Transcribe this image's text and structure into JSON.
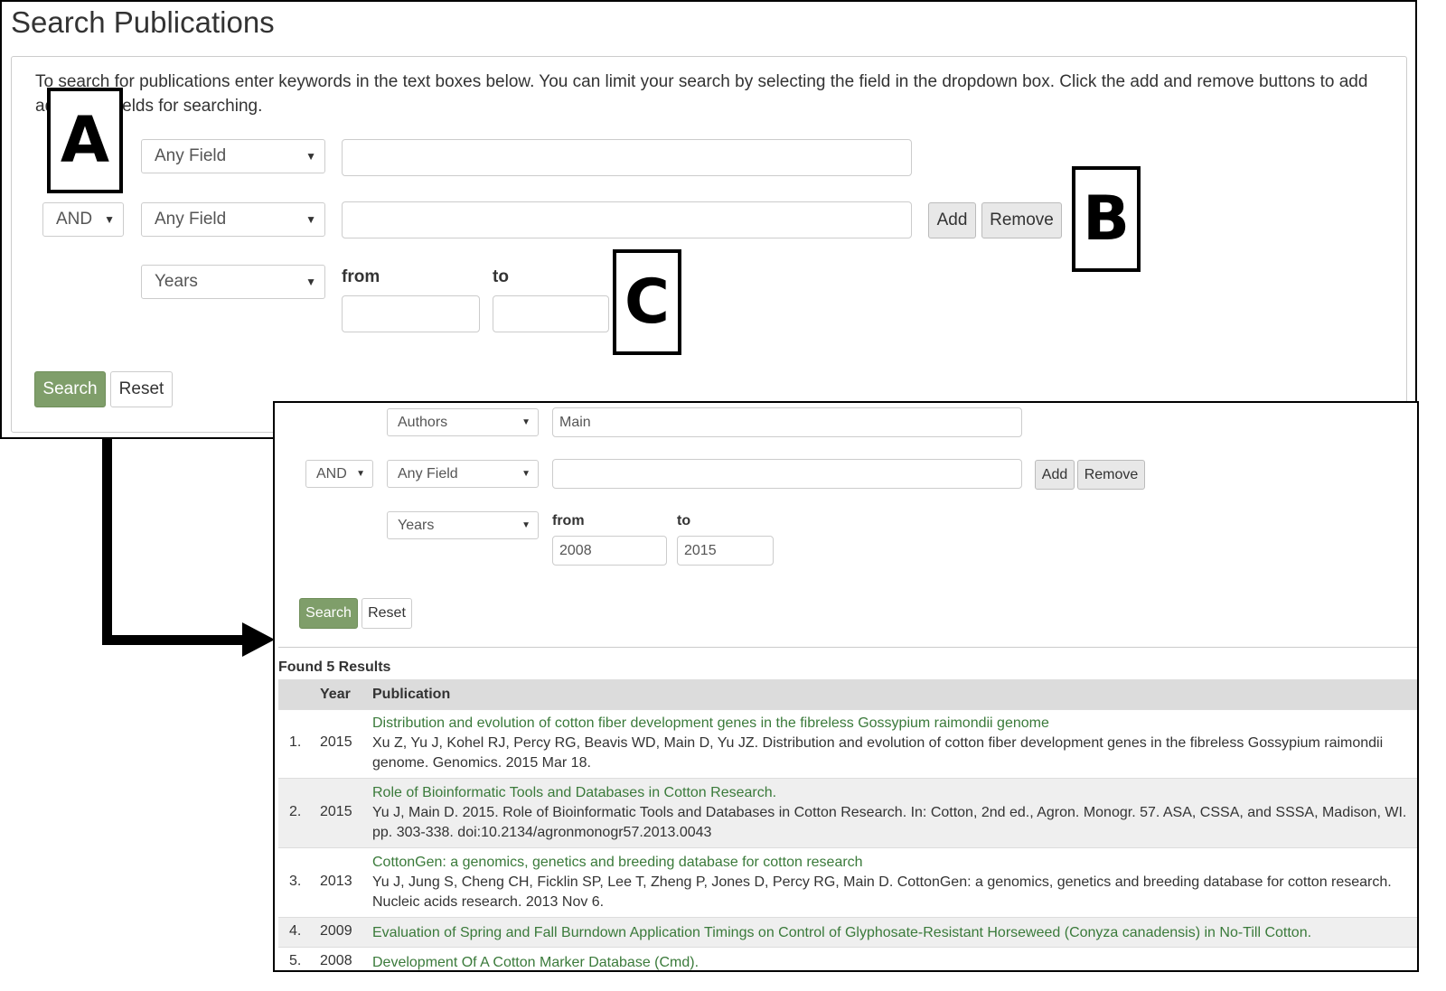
{
  "top": {
    "title": "Search Publications",
    "intro": "To search for publications enter keywords in the text boxes below. You can limit your search by selecting the field in the dropdown box. Click the add and remove buttons to add additional fields for searching.",
    "row1": {
      "field": "Any Field",
      "value": ""
    },
    "row2": {
      "operator": "AND",
      "field": "Any Field",
      "value": ""
    },
    "years": {
      "field": "Years",
      "from_label": "from",
      "to_label": "to",
      "from": "",
      "to": ""
    },
    "add_label": "Add",
    "remove_label": "Remove",
    "search_label": "Search",
    "reset_label": "Reset"
  },
  "callouts": {
    "a": "A",
    "b": "B",
    "c": "C"
  },
  "bottom": {
    "row1": {
      "field": "Authors",
      "value": "Main"
    },
    "row2": {
      "operator": "AND",
      "field": "Any Field",
      "value": ""
    },
    "years": {
      "field": "Years",
      "from_label": "from",
      "to_label": "to",
      "from": "2008",
      "to": "2015"
    },
    "add_label": "Add",
    "remove_label": "Remove",
    "search_label": "Search",
    "reset_label": "Reset",
    "found": "Found 5 Results",
    "headers": {
      "year": "Year",
      "publication": "Publication"
    },
    "results": [
      {
        "num": "1.",
        "year": "2015",
        "title": "Distribution and evolution of cotton fiber development genes in the fibreless Gossypium raimondii genome",
        "citation": "Xu Z, Yu J, Kohel RJ, Percy RG, Beavis WD, Main D, Yu JZ. Distribution and evolution of cotton fiber development genes in the fibreless Gossypium raimondii genome. Genomics. 2015 Mar 18."
      },
      {
        "num": "2.",
        "year": "2015",
        "title": "Role of Bioinformatic Tools and Databases in Cotton Research.",
        "citation": "Yu J, Main D. 2015. Role of Bioinformatic Tools and Databases in Cotton Research. In: Cotton, 2nd ed., Agron. Monogr. 57. ASA, CSSA, and SSSA, Madison, WI. pp. 303-338. doi:10.2134/agronmonogr57.2013.0043"
      },
      {
        "num": "3.",
        "year": "2013",
        "title": "CottonGen: a genomics, genetics and breeding database for cotton research",
        "citation": "Yu J, Jung S, Cheng CH, Ficklin SP, Lee T, Zheng P, Jones D, Percy RG, Main D. CottonGen: a genomics, genetics and breeding database for cotton research. Nucleic acids research. 2013 Nov 6."
      },
      {
        "num": "4.",
        "year": "2009",
        "title": "Evaluation of Spring and Fall Burndown Application Timings on Control of Glyphosate-Resistant Horseweed (Conyza canadensis) in No-Till Cotton.",
        "citation": ""
      },
      {
        "num": "5.",
        "year": "2008",
        "title": "Development Of A Cotton Marker Database (Cmd).",
        "citation": ""
      }
    ]
  },
  "colors": {
    "search_button": "#7f9e6a",
    "link_text": "#3a7a3a",
    "table_header": "#dcdcdc"
  }
}
